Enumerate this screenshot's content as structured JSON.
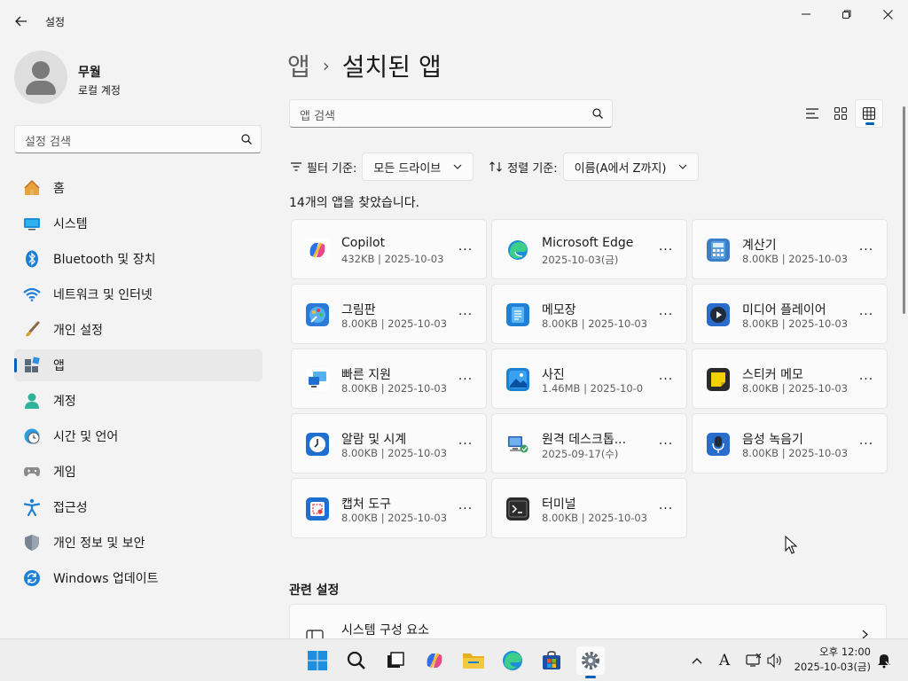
{
  "window": {
    "title": "설정"
  },
  "profile": {
    "name": "무월",
    "account_type": "로컬 계정"
  },
  "sidebar": {
    "search_placeholder": "설정 검색",
    "items": [
      {
        "label": "홈",
        "icon": "home-icon",
        "active": false
      },
      {
        "label": "시스템",
        "icon": "system-icon",
        "active": false
      },
      {
        "label": "Bluetooth 및 장치",
        "icon": "bluetooth-icon",
        "active": false
      },
      {
        "label": "네트워크 및 인터넷",
        "icon": "wifi-icon",
        "active": false
      },
      {
        "label": "개인 설정",
        "icon": "brush-icon",
        "active": false
      },
      {
        "label": "앱",
        "icon": "apps-icon",
        "active": true
      },
      {
        "label": "계정",
        "icon": "account-icon",
        "active": false
      },
      {
        "label": "시간 및 언어",
        "icon": "clock-globe-icon",
        "active": false
      },
      {
        "label": "게임",
        "icon": "gamepad-icon",
        "active": false
      },
      {
        "label": "접근성",
        "icon": "accessibility-icon",
        "active": false
      },
      {
        "label": "개인 정보 및 보안",
        "icon": "shield-icon",
        "active": false
      },
      {
        "label": "Windows 업데이트",
        "icon": "update-icon",
        "active": false
      }
    ]
  },
  "main": {
    "breadcrumb_parent": "앱",
    "breadcrumb_separator": "›",
    "breadcrumb_current": "설치된 앱",
    "search_placeholder": "앱 검색",
    "filter_label": "필터 기준:",
    "filter_value": "모든 드라이브",
    "sort_label": "정렬 기준:",
    "sort_value": "이름(A에서 Z까지)",
    "count_text": "14개의 앱을 찾았습니다.",
    "apps": [
      {
        "name": "Copilot",
        "meta": "432KB  |  2025-10-03",
        "icon": "copilot-icon"
      },
      {
        "name": "Microsoft Edge",
        "meta": "2025-10-03(금)",
        "icon": "edge-icon"
      },
      {
        "name": "계산기",
        "meta": "8.00KB  |  2025-10-03",
        "icon": "calculator-icon"
      },
      {
        "name": "그림판",
        "meta": "8.00KB  |  2025-10-03",
        "icon": "paint-icon"
      },
      {
        "name": "메모장",
        "meta": "8.00KB  |  2025-10-03",
        "icon": "notepad-icon"
      },
      {
        "name": "미디어 플레이어",
        "meta": "8.00KB  |  2025-10-03",
        "icon": "media-player-icon"
      },
      {
        "name": "빠른 지원",
        "meta": "8.00KB  |  2025-10-03",
        "icon": "quick-assist-icon"
      },
      {
        "name": "사진",
        "meta": "1.46MB  |  2025-10-0",
        "icon": "photos-icon"
      },
      {
        "name": "스티커 메모",
        "meta": "8.00KB  |  2025-10-03",
        "icon": "sticky-notes-icon"
      },
      {
        "name": "알람 및 시계",
        "meta": "8.00KB  |  2025-10-03",
        "icon": "alarm-clock-icon"
      },
      {
        "name": "원격 데스크톱...",
        "meta": "2025-09-17(수)",
        "icon": "remote-desktop-icon"
      },
      {
        "name": "음성 녹음기",
        "meta": "8.00KB  |  2025-10-03",
        "icon": "voice-recorder-icon"
      },
      {
        "name": "캡처 도구",
        "meta": "8.00KB  |  2025-10-03",
        "icon": "snipping-tool-icon"
      },
      {
        "name": "터미널",
        "meta": "8.00KB  |  2025-10-03",
        "icon": "terminal-icon"
      }
    ],
    "more_label": "···",
    "related_title": "관련 설정",
    "related_item": "시스템 구성 요소"
  },
  "taskbar": {
    "clock_time": "오후 12:00",
    "clock_date": "2025-10-03(금)",
    "ime_label": "A"
  },
  "colors": {
    "accent": "#005fb8",
    "window_bg": "#f3f3f3",
    "card_bg": "#fbfbfb"
  }
}
